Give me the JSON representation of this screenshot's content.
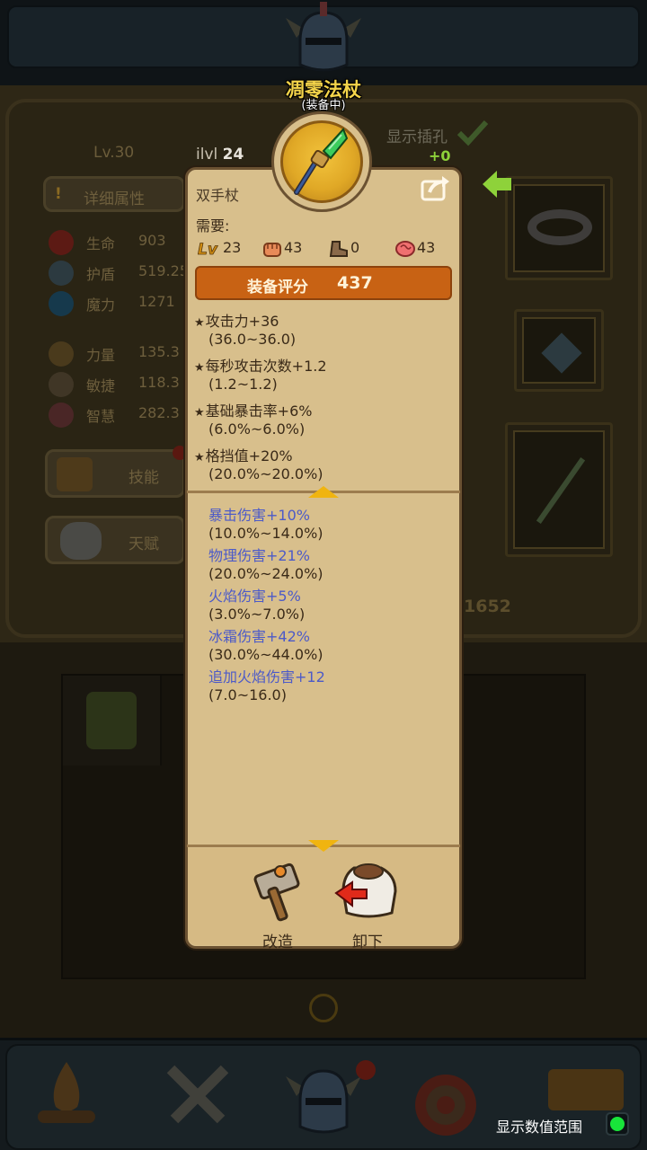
{
  "item": {
    "name": "凋零法杖",
    "status": "(装备中)",
    "ilvl_label": "ilvl",
    "ilvl_value": "24",
    "type": "双手杖",
    "requirements_label": "需要:",
    "requirements": {
      "level": "23",
      "strength": "43",
      "agility": "0",
      "intelligence": "43"
    },
    "score_label": "装备评分",
    "score_value": "437",
    "base_attributes": [
      {
        "text": "攻击力+36",
        "range": "(36.0~36.0)"
      },
      {
        "text": "每秒攻击次数+1.2",
        "range": "(1.2~1.2)"
      },
      {
        "text": "基础暴击率+6%",
        "range": "(6.0%~6.0%)"
      },
      {
        "text": "格挡值+20%",
        "range": "(20.0%~20.0%)"
      }
    ],
    "affixes": [
      {
        "text": "暴击伤害+10%",
        "range": "(10.0%~14.0%)"
      },
      {
        "text": "物理伤害+21%",
        "range": "(20.0%~24.0%)"
      },
      {
        "text": "火焰伤害+5%",
        "range": "(3.0%~7.0%)"
      },
      {
        "text": "冰霜伤害+42%",
        "range": "(30.0%~44.0%)"
      },
      {
        "text": "追加火焰伤害+12",
        "range": "(7.0~16.0)"
      }
    ],
    "actions": {
      "reforge_label": "改造",
      "unequip_label": "卸下"
    }
  },
  "character": {
    "level": "Lv.30",
    "details_label": "详细属性",
    "socket_label": "显示插孔",
    "socket_bonus": "+0",
    "stats": [
      {
        "label": "生命",
        "value": "903"
      },
      {
        "label": "护盾",
        "value": "519.25"
      },
      {
        "label": "魔力",
        "value": "1271"
      },
      {
        "label": "力量",
        "value": "135.3"
      },
      {
        "label": "敏捷",
        "value": "118.3"
      },
      {
        "label": "智慧",
        "value": "282.3"
      }
    ],
    "skills_label": "技能",
    "talents_label": "天赋",
    "power_value": "1652"
  },
  "footer": {
    "range_toggle_label": "显示数值范围",
    "range_toggle_on": true
  },
  "colors": {
    "item_name": "#f4d44a",
    "score_bar": "#c86214",
    "affix_text": "#4c5ac8",
    "toggle_on": "#18e43a",
    "socket_bonus": "#8ed23a"
  }
}
